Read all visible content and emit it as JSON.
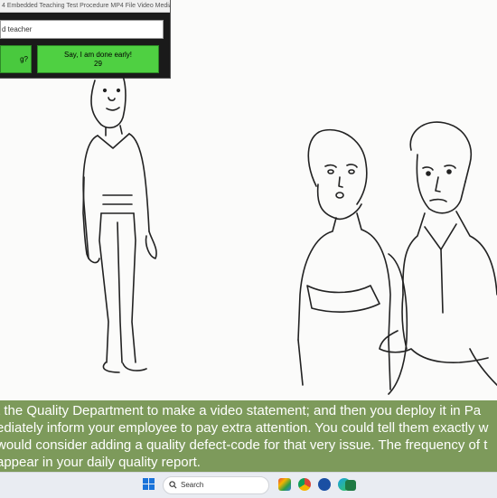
{
  "popup": {
    "title": "4 Embedded Teaching Test Procedure MP4 File Video Media.M...",
    "input_value": "d teacher",
    "left_button_label": "g?",
    "done_button_label": "Say, I am done early!",
    "done_button_count": "29"
  },
  "caption": {
    "lines": [
      "t the Quality Department to make a video statement; and then you deploy it in Pa",
      "ediately inform your employee to pay extra attention. You could tell them exactly w",
      "would consider adding a quality defect-code for that very issue. The frequency of t",
      "appear in your daily quality report."
    ]
  },
  "taskbar": {
    "search_placeholder": "Search",
    "icons": [
      "windows-start-icon",
      "search-icon",
      "colorful-app-icon",
      "chrome-icon",
      "blue-circle-app-icon",
      "edge-icon",
      "excel-icon"
    ]
  }
}
